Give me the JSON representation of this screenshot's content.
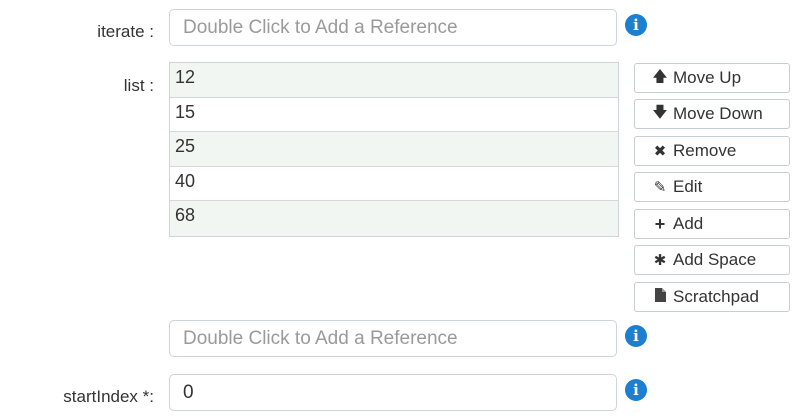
{
  "iterate": {
    "label": "iterate :",
    "placeholder": "Double Click to Add a Reference",
    "info_icon": "info-circle-icon"
  },
  "list": {
    "label": "list :",
    "items": [
      "12",
      "15",
      "25",
      "40",
      "68"
    ],
    "add_placeholder": "Double Click to Add a Reference",
    "info_icon": "info-circle-icon"
  },
  "actions": {
    "move_up": {
      "icon": "arrow-up-icon",
      "label": "Move Up"
    },
    "move_down": {
      "icon": "arrow-down-icon",
      "label": "Move Down"
    },
    "remove": {
      "icon": "times-icon",
      "label": "Remove"
    },
    "edit": {
      "icon": "pencil-icon",
      "label": "Edit"
    },
    "add": {
      "icon": "plus-icon",
      "label": "Add"
    },
    "add_space": {
      "icon": "asterisk-icon",
      "label": "Add Space"
    },
    "scratchpad": {
      "icon": "file-icon",
      "label": "Scratchpad"
    }
  },
  "startIndex": {
    "label": "startIndex *:",
    "value": "0",
    "info_icon": "info-circle-icon"
  },
  "colors": {
    "info": "#1c7fd0",
    "row_alt": "#f2f6f2"
  }
}
